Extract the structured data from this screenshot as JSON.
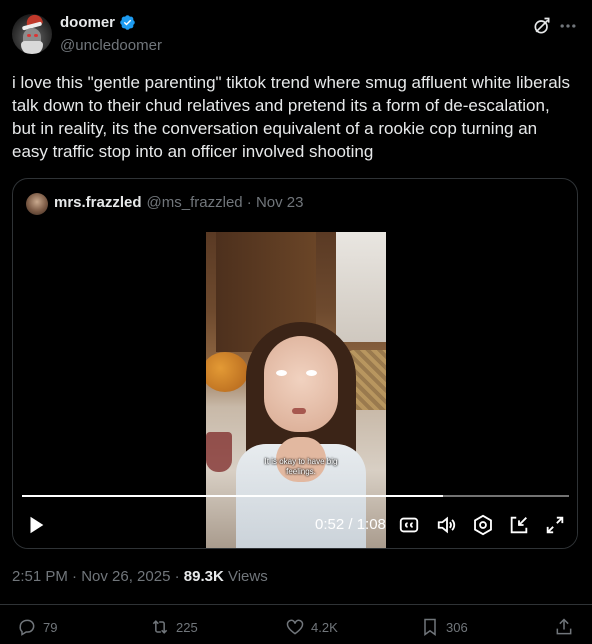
{
  "author": {
    "display_name": "doomer",
    "handle": "@uncledoomer"
  },
  "post": {
    "text": "i love this \"gentle parenting\" tiktok trend where smug affluent white liberals talk down to their chud relatives and pretend its a form of de-escalation, but in reality, its the conversation equivalent of a rookie cop turning an easy traffic stop into an officer involved shooting",
    "timestamp": "2:51 PM · Nov 26, 2025 · ",
    "views_count": "89.3K",
    "views_label": " Views"
  },
  "quote": {
    "display_name": "mrs.frazzled",
    "handle_date": "@ms_frazzled · Nov 23",
    "video": {
      "caption": "It is okay to have big feelings.",
      "time": "0:52 / 1:08",
      "progress": 0.769
    }
  },
  "actions": {
    "replies": "79",
    "reposts": "225",
    "likes": "4.2K",
    "bookmarks": "306"
  },
  "colors": {
    "background": "#000000",
    "text": "#e7e9ea",
    "secondary": "#71767b",
    "verified": "#1d9bf0",
    "border": "#2f3336"
  },
  "icons": [
    "verified-badge-icon",
    "grok-icon",
    "more-icon",
    "play-icon",
    "cc-icon",
    "volume-icon",
    "settings-icon",
    "dock-icon",
    "fullscreen-icon",
    "reply-icon",
    "repost-icon",
    "like-icon",
    "bookmark-icon",
    "share-icon"
  ]
}
